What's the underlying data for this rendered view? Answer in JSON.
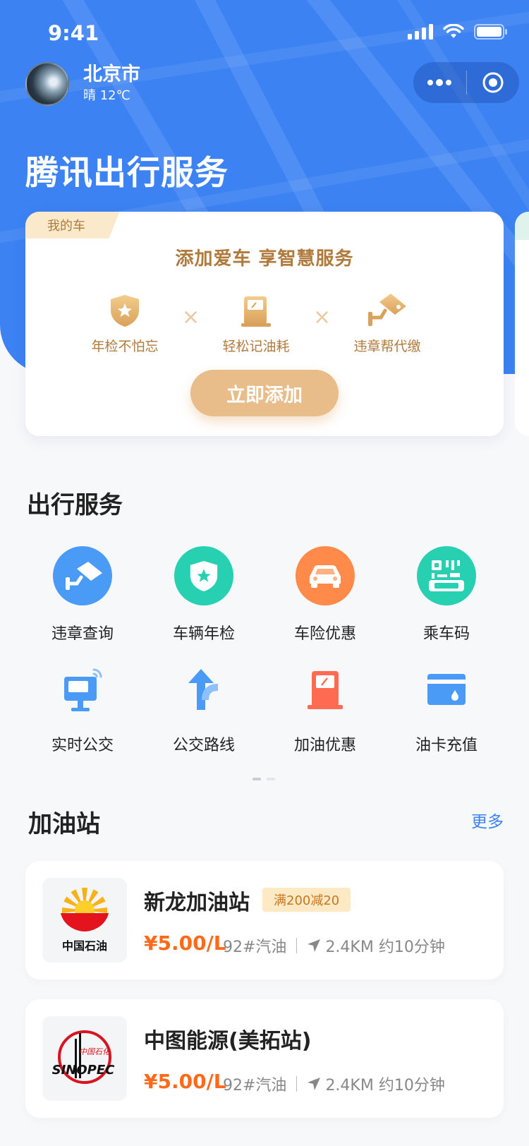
{
  "status_bar": {
    "time": "9:41"
  },
  "location": {
    "city": "北京市",
    "weather": "晴 12℃"
  },
  "header": {
    "title": "腾讯出行服务"
  },
  "car_card": {
    "tag": "我的车",
    "headline": "添加爱车 享智慧服务",
    "features": [
      {
        "label": "年检不怕忘",
        "icon": "shield-star-icon"
      },
      {
        "label": "轻松记油耗",
        "icon": "fuel-pump-icon"
      },
      {
        "label": "违章帮代缴",
        "icon": "camera-icon"
      }
    ],
    "separator": "×",
    "button": "立即添加"
  },
  "services": {
    "title": "出行服务",
    "items": [
      {
        "label": "违章查询",
        "icon": "traffic-camera-icon",
        "color": "#4a9bf6"
      },
      {
        "label": "车辆年检",
        "icon": "shield-star-icon",
        "color": "#26d0b0"
      },
      {
        "label": "车险优惠",
        "icon": "car-icon",
        "color": "#ff8a4a"
      },
      {
        "label": "乘车码",
        "icon": "qr-code-icon",
        "color": "#26d0b0"
      },
      {
        "label": "实时公交",
        "icon": "bus-stop-display-icon",
        "color": "#4a9bf6"
      },
      {
        "label": "公交路线",
        "icon": "route-arrow-icon",
        "color": "#4a9bf6"
      },
      {
        "label": "加油优惠",
        "icon": "fuel-pump-icon",
        "color": "#ff6b52"
      },
      {
        "label": "油卡充值",
        "icon": "fuel-card-icon",
        "color": "#4a9bf6"
      }
    ]
  },
  "gas_stations": {
    "title": "加油站",
    "more": "更多",
    "items": [
      {
        "name": "新龙加油站",
        "promo": "满200减20",
        "price": "¥5.00/L",
        "fuel": "92#汽油",
        "distance": "2.4KM 约10分钟",
        "logo": "petrochina-logo",
        "logo_text": "中国石油"
      },
      {
        "name": "中图能源(美拓站)",
        "promo": "",
        "price": "¥5.00/L",
        "fuel": "92#汽油",
        "distance": "2.4KM 约10分钟",
        "logo": "sinopec-logo",
        "logo_text": "SINOPEC"
      }
    ]
  }
}
